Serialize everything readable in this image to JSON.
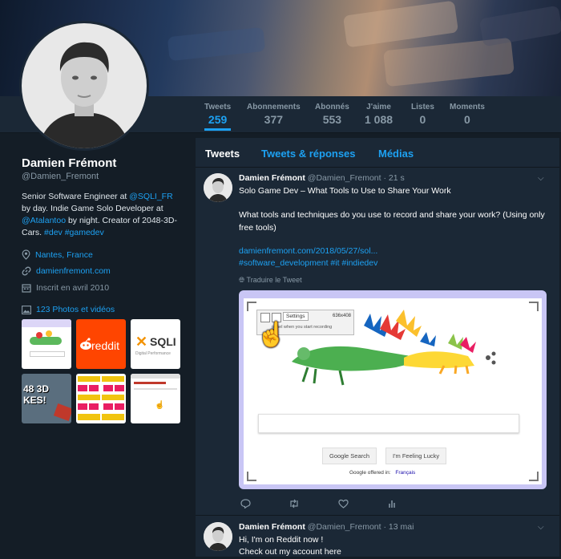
{
  "profile": {
    "name": "Damien Frémont",
    "handle": "@Damien_Fremont",
    "bio_1": "Senior Software Engineer at ",
    "bio_mention_1": "@SQLI_FR",
    "bio_2": " by day. Indie Game Solo Developer at ",
    "bio_mention_2": "@Atalantoo",
    "bio_3": " by night. Creator of 2048-3D-Cars. ",
    "bio_tags": "#dev #gamedev",
    "location": "Nantes, France",
    "website": "damienfremont.com",
    "joined": "Inscrit en avril 2010",
    "photos_label": "123 Photos et vidéos"
  },
  "stats": [
    {
      "label": "Tweets",
      "value": "259"
    },
    {
      "label": "Abonnements",
      "value": "377"
    },
    {
      "label": "Abonnés",
      "value": "553"
    },
    {
      "label": "J'aime",
      "value": "1 088"
    },
    {
      "label": "Listes",
      "value": "0"
    },
    {
      "label": "Moments",
      "value": "0"
    }
  ],
  "tabs": [
    "Tweets",
    "Tweets & réponses",
    "Médias"
  ],
  "thumbs": {
    "reddit": "reddit",
    "sqli": "SQLI",
    "sqli_sub": "Digital Performance",
    "cars": "48 3D KES!"
  },
  "tweet1": {
    "name": "Damien Frémont",
    "handle": "@Damien_Fremont · 21 s",
    "line1": "Solo Game Dev – What Tools to Use to Share Your Work",
    "line2": "What tools and techniques do you use to record and share your work? (Using only free tools)",
    "link": "damienfremont.com/2018/05/27/sol...",
    "tags": "#software_development #it #indiedev",
    "translate": "Traduire le Tweet",
    "media": {
      "settings": "Settings",
      "size": "636x408",
      "hint": "panel when you start recording",
      "search_btn": "Google Search",
      "lucky_btn": "I'm Feeling Lucky",
      "offered": "Google offered in:",
      "lang": "Français"
    }
  },
  "tweet2": {
    "name": "Damien Frémont",
    "handle": "@Damien_Fremont · 13 mai",
    "line1": "Hi, I'm on Reddit now !",
    "line2": "Check out my account here"
  },
  "colors": {
    "accent": "#1da1f2",
    "bg": "#141d26",
    "panel": "#1b2836",
    "muted": "#8899a6"
  }
}
